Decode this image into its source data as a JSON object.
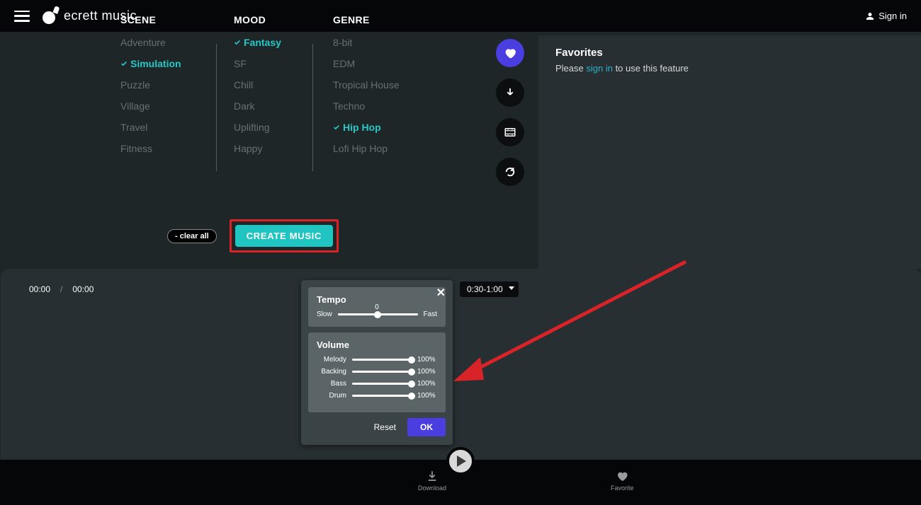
{
  "brand": {
    "name": "ecrett music"
  },
  "header": {
    "signin": "Sign in"
  },
  "columns": {
    "scene": {
      "header": "SCENE",
      "items": [
        "Adventure",
        "Simulation",
        "Puzzle",
        "Village",
        "Travel",
        "Fitness"
      ],
      "selected": "Simulation"
    },
    "mood": {
      "header": "MOOD",
      "items": [
        "Fantasy",
        "SF",
        "Chill",
        "Dark",
        "Uplifting",
        "Happy"
      ],
      "selected": "Fantasy"
    },
    "genre": {
      "header": "GENRE",
      "items": [
        "8-bit",
        "EDM",
        "Tropical House",
        "Techno",
        "Hip Hop",
        "Lofi Hip Hop"
      ],
      "selected": "Hip Hop"
    }
  },
  "actions": {
    "clear": "- clear all",
    "create": "CREATE MUSIC"
  },
  "favorites": {
    "title": "Favorites",
    "prefix": "Please ",
    "link": "sign in",
    "suffix": " to use this feature"
  },
  "timeline": {
    "current": "00:00",
    "total": "00:00",
    "duration_selected": "0:30-1:00"
  },
  "popup": {
    "tempo": {
      "title": "Tempo",
      "slow": "Slow",
      "fast": "Fast",
      "value": "0",
      "position_pct": 50
    },
    "volume": {
      "title": "Volume",
      "tracks": [
        {
          "label": "Melody",
          "pct": "100%"
        },
        {
          "label": "Backing",
          "pct": "100%"
        },
        {
          "label": "Bass",
          "pct": "100%"
        },
        {
          "label": "Drum",
          "pct": "100%"
        }
      ]
    },
    "reset": "Reset",
    "ok": "OK"
  },
  "bottom": {
    "download": "Download",
    "favorite": "Favorite"
  }
}
